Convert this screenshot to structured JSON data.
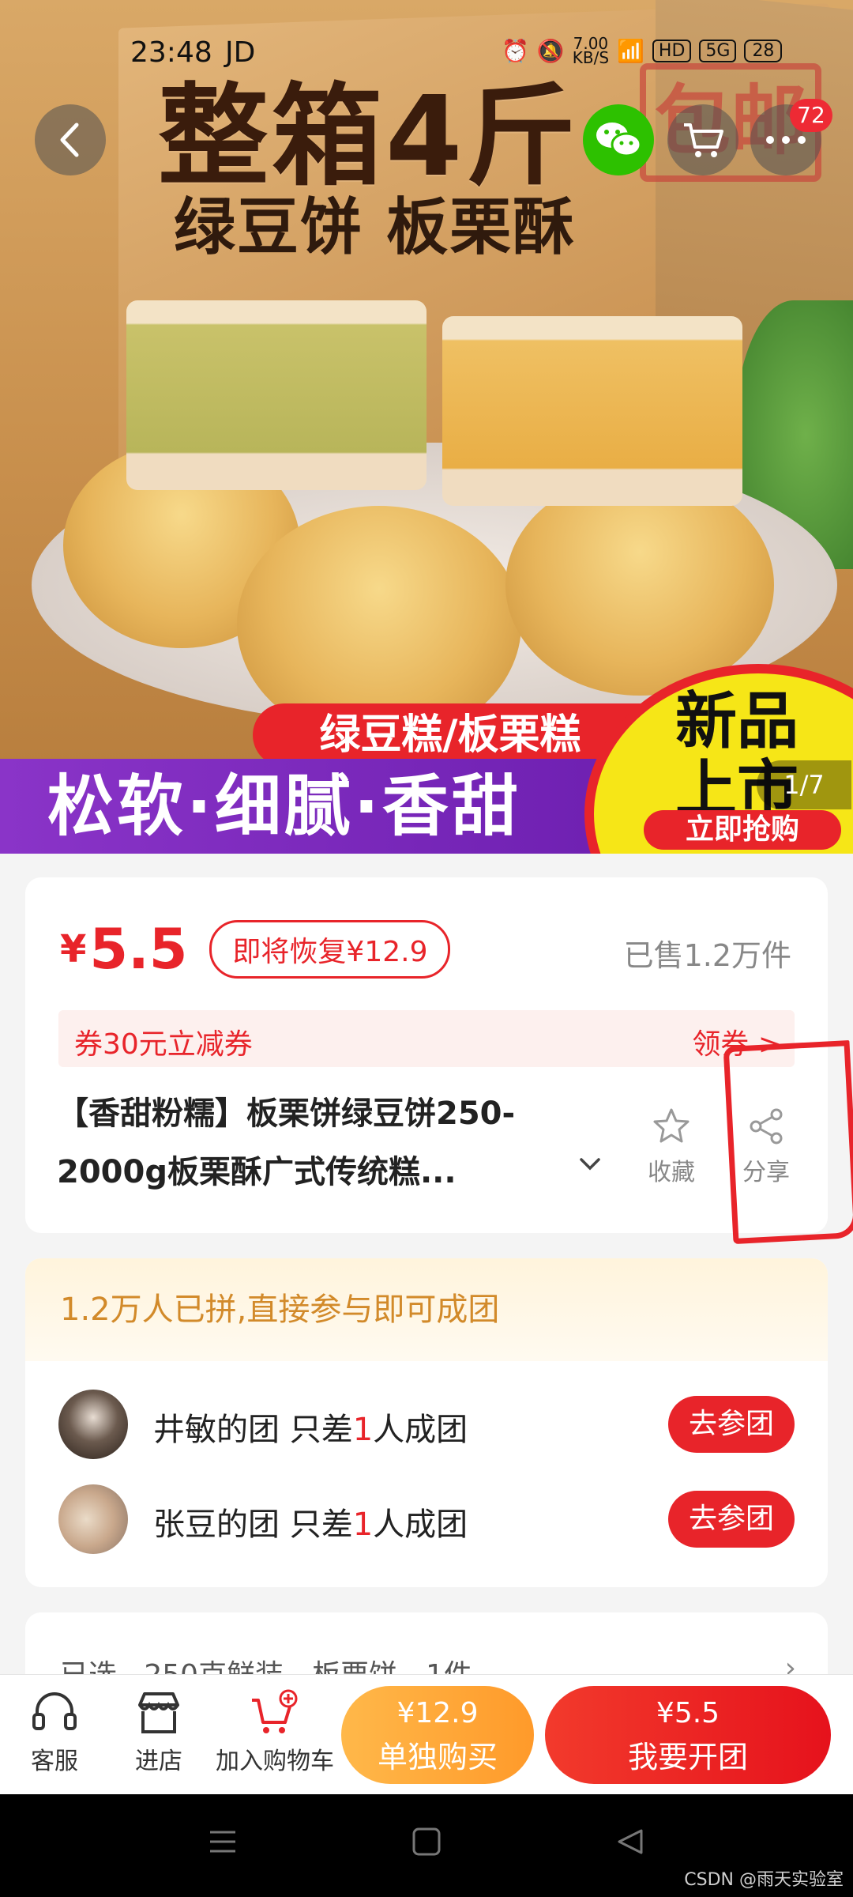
{
  "status_bar": {
    "time": "23:48",
    "carrier": "JD",
    "speed": "7.00\nKB/S",
    "hd": "HD",
    "net": "5G",
    "battery": "28"
  },
  "hero": {
    "title": "整箱4斤",
    "subtitle": "绿豆饼 板栗酥",
    "stamp": "包邮",
    "red_strip": "绿豆糕/板栗糕",
    "purple_banner": "松软·细腻·香甜",
    "new_badge": "新品\n上市",
    "buy_now": "立即抢购",
    "page_indicator": "1/7",
    "cart_count": "72"
  },
  "product": {
    "currency": "¥",
    "price": "5.5",
    "restore_label": "即将恢复¥12.9",
    "sold": "已售1.2万件",
    "coupon": "券30元立减券",
    "coupon_action": "领券 >",
    "title": "【香甜粉糯】板栗饼绿豆饼250-2000g板栗酥广式传统糕...",
    "favorite_label": "收藏",
    "share_label": "分享"
  },
  "group_buy": {
    "header": "1.2万人已拼,直接参与即可成团",
    "rows": [
      {
        "name_prefix": "井敏的团 只差",
        "count": "1",
        "suffix": "人成团",
        "button": "去参团"
      },
      {
        "name_prefix": "张豆的团 只差",
        "count": "1",
        "suffix": "人成团",
        "button": "去参团"
      }
    ]
  },
  "selected": {
    "label": "已选",
    "value": "250克鲜装，板栗饼，1件"
  },
  "bottom_bar": {
    "service": "客服",
    "store": "进店",
    "add_cart": "加入购物车",
    "solo_price": "¥12.9",
    "solo_label": "单独购买",
    "group_price": "¥5.5",
    "group_label": "我要开团"
  },
  "watermark": "CSDN @雨天实验室",
  "colors": {
    "accent": "#e8242a",
    "wechat": "#2dc100",
    "solo": "#ff9a2a"
  }
}
